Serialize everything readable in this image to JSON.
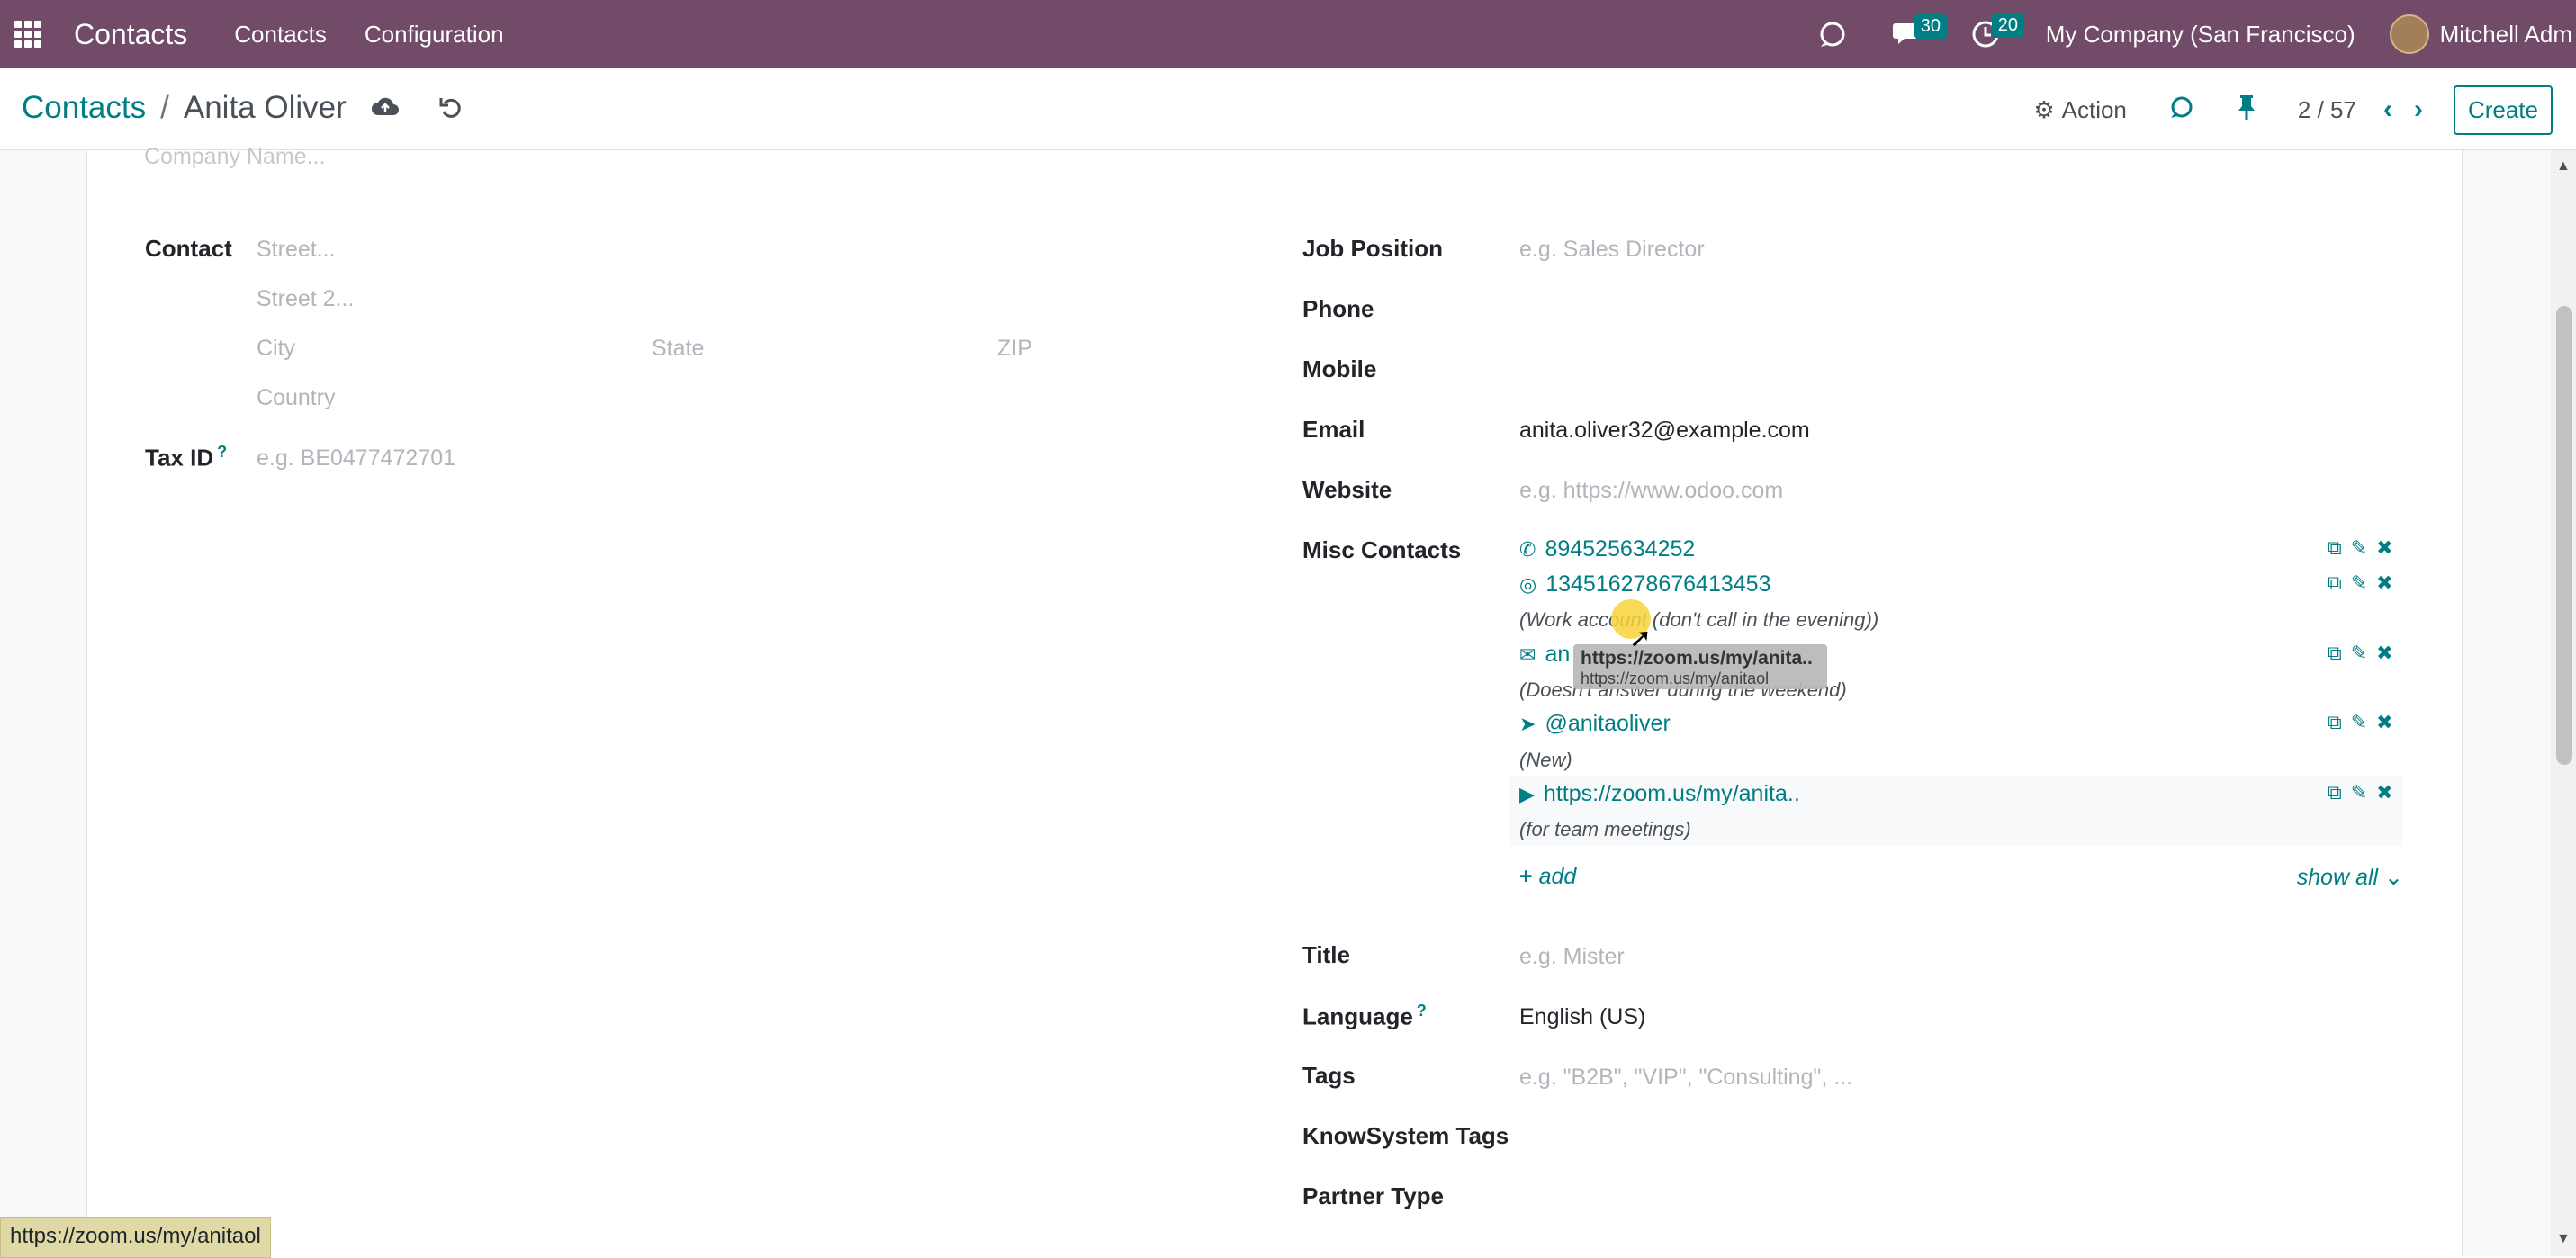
{
  "navbar": {
    "brand": "Contacts",
    "menu": [
      "Contacts",
      "Configuration"
    ],
    "chat_count": "30",
    "activity_count": "20",
    "company": "My Company (San Francisco)",
    "user": "Mitchell Adm",
    "bg_color": "#714b67"
  },
  "control": {
    "breadcrumb_parent": "Contacts",
    "breadcrumb_sep": "/",
    "record_name": "Anita Oliver",
    "action_label": "Action",
    "pager": "2 / 57",
    "create_label": "Create"
  },
  "form": {
    "company_name_placeholder": "Company Name...",
    "contact_label": "Contact",
    "street_ph": "Street...",
    "street2_ph": "Street 2...",
    "city_ph": "City",
    "state_ph": "State",
    "zip_ph": "ZIP",
    "country_ph": "Country",
    "tax_label": "Tax ID",
    "tax_help": "?",
    "tax_ph": "e.g. BE0477472701",
    "job_label": "Job Position",
    "job_ph": "e.g. Sales Director",
    "phone_label": "Phone",
    "mobile_label": "Mobile",
    "email_label": "Email",
    "email_value": "anita.oliver32@example.com",
    "website_label": "Website",
    "website_ph": "e.g. https://www.odoo.com",
    "misc_label": "Misc Contacts",
    "misc": {
      "phone": "894525634252",
      "whatsapp": "134516278676413453",
      "whatsapp_note": "(Work account (don't call in the evening))",
      "email_partial": "an",
      "email_note": "(Doesn't answer during the weekend)",
      "telegram": "@anitaoliver",
      "telegram_note": "(New)",
      "zoom": "https://zoom.us/my/anita..",
      "zoom_note": "(for team meetings)"
    },
    "add_label": "add",
    "show_all_label": "show all",
    "title_label": "Title",
    "title_ph": "e.g. Mister",
    "language_label": "Language",
    "language_help": "?",
    "language_value": "English (US)",
    "tags_label": "Tags",
    "tags_ph": "e.g. \"B2B\", \"VIP\", \"Consulting\", ...",
    "knowsystem_label": "KnowSystem Tags",
    "partner_type_label": "Partner Type"
  },
  "tooltip": {
    "title": "https://zoom.us/my/anita..",
    "url": "https://zoom.us/my/anitaol"
  },
  "status_link": "https://zoom.us/my/anitaol",
  "accent_color": "#017e84"
}
